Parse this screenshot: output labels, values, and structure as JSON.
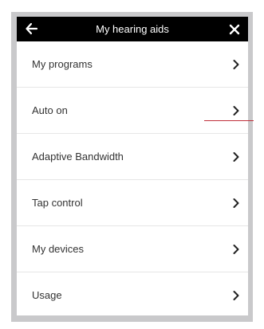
{
  "header": {
    "title": "My hearing aids",
    "back_icon": "arrow-left-icon",
    "close_icon": "close-x-icon"
  },
  "menu": {
    "items": [
      {
        "label": "My programs",
        "icon": "chevron-right-icon"
      },
      {
        "label": "Auto on",
        "icon": "chevron-right-icon"
      },
      {
        "label": "Adaptive Bandwidth",
        "icon": "chevron-right-icon"
      },
      {
        "label": "Tap control",
        "icon": "chevron-right-icon"
      },
      {
        "label": "My devices",
        "icon": "chevron-right-icon"
      },
      {
        "label": "Usage",
        "icon": "chevron-right-icon"
      }
    ]
  },
  "colors": {
    "header_bg": "#000000",
    "header_text": "#ffffff",
    "frame_bg": "#c9c9cb",
    "row_text": "#333333",
    "divider": "#e6e6e6",
    "annotation_line": "#c0303a"
  }
}
